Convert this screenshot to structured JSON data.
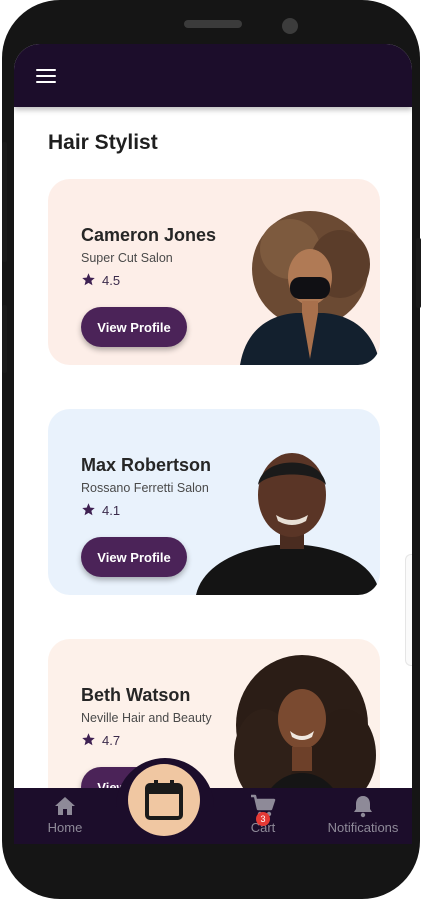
{
  "page_title": "Hair Stylist",
  "stylists": [
    {
      "name": "Cameron Jones",
      "salon": "Super Cut Salon",
      "rating": "4.5",
      "button": "View Profile",
      "card_color": "#fdeee8"
    },
    {
      "name": "Max Robertson",
      "salon": "Rossano Ferretti Salon",
      "rating": "4.1",
      "button": "View Profile",
      "card_color": "#e9f2fc"
    },
    {
      "name": "Beth Watson",
      "salon": "Neville Hair and Beauty",
      "rating": "4.7",
      "button": "View Profile",
      "card_color": "#fdf1ea"
    }
  ],
  "nav": {
    "home_label": "Home",
    "cart_label": "Cart",
    "cart_badge": "3",
    "notifications_label": "Notifications"
  },
  "colors": {
    "appbar": "#1c0d2b",
    "button": "#4b2358",
    "fab": "#f0c7a2",
    "badge": "#e53935"
  },
  "icons": [
    "menu-icon",
    "star-icon",
    "home-icon",
    "calendar-icon",
    "cart-icon",
    "bell-icon"
  ]
}
